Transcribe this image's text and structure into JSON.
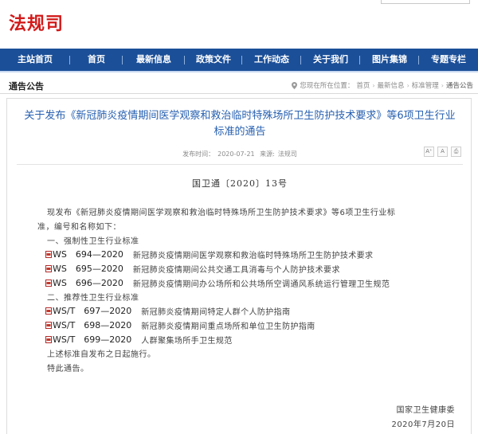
{
  "site": {
    "name": "法规司"
  },
  "nav": {
    "items": [
      {
        "label": "主站首页"
      },
      {
        "label": "首页"
      },
      {
        "label": "最新信息"
      },
      {
        "label": "政策文件"
      },
      {
        "label": "工作动态"
      },
      {
        "label": "关于我们"
      },
      {
        "label": "图片集锦"
      },
      {
        "label": "专题专栏"
      }
    ]
  },
  "section": {
    "title": "通告公告"
  },
  "breadcrumb": {
    "prefix": "您现在所在位置：",
    "items": [
      "首页",
      "最新信息",
      "标准管理",
      "通告公告"
    ]
  },
  "article": {
    "title": "关于发布《新冠肺炎疫情期间医学观察和救治临时特殊场所卫生防护技术要求》等6项卫生行业标准的通告",
    "date_label": "发布时间：",
    "date": "2020-07-21",
    "source_label": "来源:",
    "source": "法规司",
    "tools": {
      "font_label": "A⁺",
      "font_small_label": "A",
      "print_label": "⎙"
    },
    "doc_number": "国卫通〔2020〕13号",
    "intro_1": "现发布《新冠肺炎疫情期间医学观察和救治临时特殊场所卫生防护技术要求》等6项卫生行业标",
    "intro_2": "准，编号和名称如下：",
    "mandatory_heading": "一、强制性卫生行业标准",
    "mandatory": [
      {
        "code": "WS　694—2020",
        "name": "新冠肺炎疫情期间医学观察和救治临时特殊场所卫生防护技术要求"
      },
      {
        "code": "WS　695—2020",
        "name": "新冠肺炎疫情期间公共交通工具消毒与个人防护技术要求"
      },
      {
        "code": "WS　696—2020",
        "name": "新冠肺炎疫情期间办公场所和公共场所空调通风系统运行管理卫生规范"
      }
    ],
    "recommended_heading": "二、推荐性卫生行业标准",
    "recommended": [
      {
        "code": "WS/T　697—2020",
        "name": "新冠肺炎疫情期间特定人群个人防护指南"
      },
      {
        "code": "WS/T　698—2020",
        "name": "新冠肺炎疫情期间重点场所和单位卫生防护指南"
      },
      {
        "code": "WS/T　699—2020",
        "name": "人群聚集场所手卫生规范"
      }
    ],
    "effective": "上述标准自发布之日起施行。",
    "closing": "特此通告。",
    "signer": "国家卫生健康委",
    "sign_date": "2020年7月20日"
  },
  "colors": {
    "nav_bg": "#1b4f98",
    "site_name": "#d21a1a",
    "title": "#2760b0"
  }
}
